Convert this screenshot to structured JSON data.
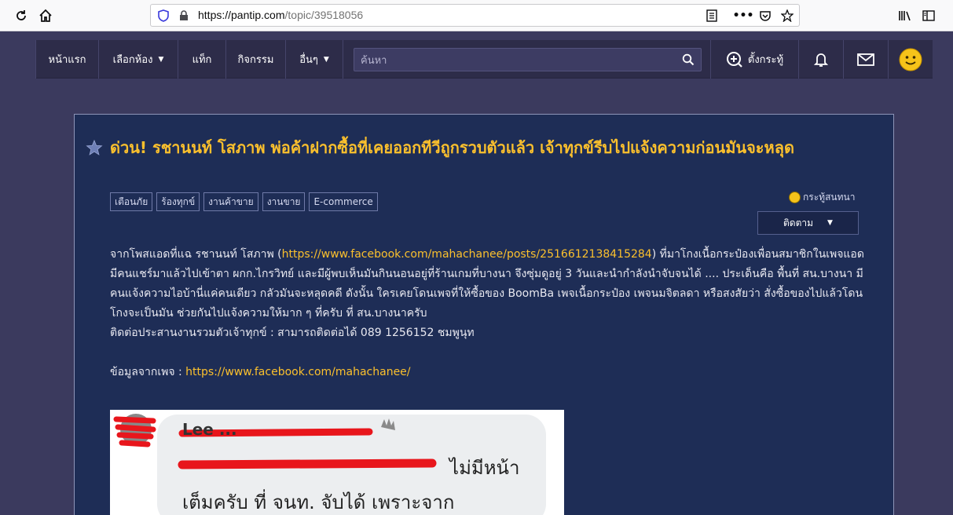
{
  "browser": {
    "url_host": "https://pantip.com",
    "url_path": "/topic/39518056",
    "icons": [
      "reload-icon",
      "home-icon",
      "shield-icon",
      "lock-icon",
      "reader-icon",
      "more-icon",
      "pocket-icon",
      "bookmark-star-icon",
      "library-icon",
      "sidebar-icon"
    ]
  },
  "site_nav": {
    "items": [
      {
        "label": "หน้าแรก"
      },
      {
        "label": "เลือกห้อง"
      },
      {
        "label": "แท็ก"
      },
      {
        "label": "กิจกรรม"
      },
      {
        "label": "อื่นๆ"
      }
    ],
    "search_placeholder": "ค้นหา",
    "new_topic_label": "ตั้งกระทู้"
  },
  "topic": {
    "title": "ด่วน! รชานนท์ โสภาพ พ่อค้าฝากซื้อที่เคยออกทีวีถูกรวบตัวแล้ว เจ้าทุกข์รีบไปแจ้งความก่อนมันจะหลุด",
    "tags": [
      "เตือนภัย",
      "ร้องทุกข์",
      "งานค้าขาย",
      "งานขาย",
      "E-commerce"
    ],
    "post_type": "กระทู้สนทนา",
    "follow_label": "ติดตาม",
    "body": {
      "p1_before": "จากโพสแอดที่แฉ รชานนท์ โสภาพ (",
      "p1_link": "https://www.facebook.com/mahachanee/posts/2516612138415284",
      "p1_after": ") ที่มาโกงเนื้อกระป๋องเพื่อนสมาชิกในเพจแอด มีคนแชร์มาแล้วไปเข้าตา ผกก.ไกรวิทย์ และมีผู้พบเห็นมันกินนอนอยู่ที่ร้านเกมที่บางนา จึงซุ่มดูอยู่ 3 วันและนำกำลังนำจับจนได้ .... ประเด็นคือ พื้นที่ สน.บางนา มีคนแจ้งความไอบ้านี่แค่คนเดียว กลัวมันจะหลุดคดี ดังนั้น ใครเคยโดนเพจที่ให้ซื้อของ BoomBa เพจเนื้อกระป๋อง เพจนมจิตลดา หรือสงสัยว่า สั่งซื้อของไปแล้วโดนโกงจะเป็นมัน ช่วยกันไปแจ้งความให้มาก ๆ ที่ครับ ที่ สน.บางนาครับ",
      "p2": "ติดต่อประสานงานรวมตัวเจ้าทุกข์ : สามารถติดต่อได้ 089 1256152 ชมพูนุท",
      "p3_label": "ข้อมูลจากเพจ : ",
      "p3_link": "https://www.facebook.com/mahachanee/"
    },
    "image_text": {
      "line1": "ไม่มีหน้า",
      "line2": "เต็มครับ ที่ จนท. จับได้ เพราะจาก"
    }
  },
  "colors": {
    "accent_yellow": "#fbc02d",
    "nav_bg": "#2d2c49",
    "card_bg": "#1e2d56",
    "page_bg": "#3b3a5e"
  }
}
